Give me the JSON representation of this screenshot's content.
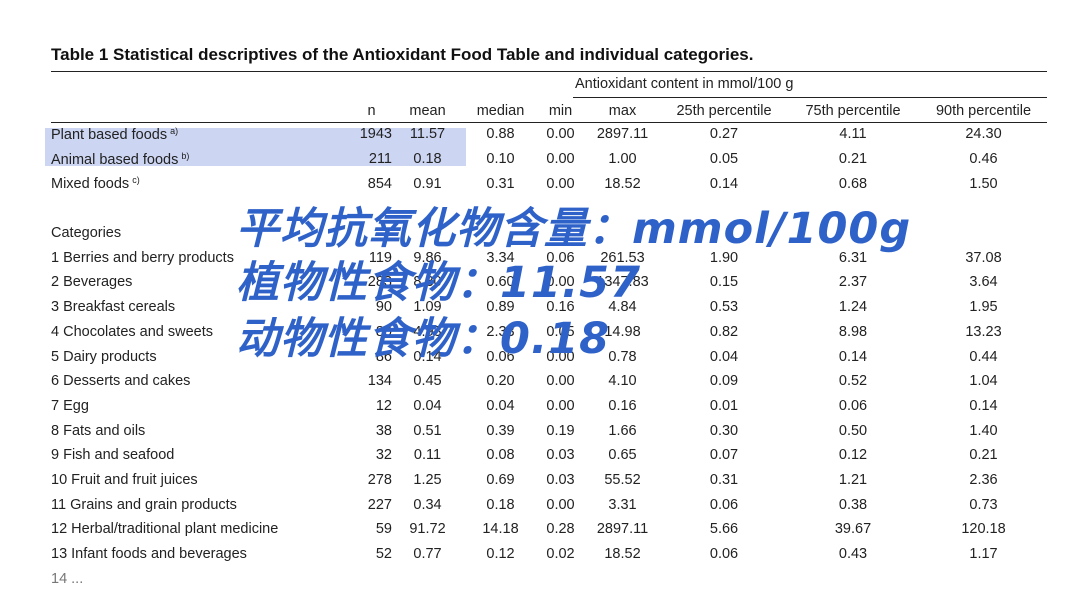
{
  "table": {
    "title": "Table 1 Statistical descriptives of the Antioxidant Food Table and individual categories.",
    "group_header": "Antioxidant content in mmol/100 g",
    "columns": [
      "n",
      "mean",
      "median",
      "min",
      "max",
      "25th percentile",
      "75th percentile",
      "90th percentile"
    ],
    "rows": [
      {
        "label": "Plant based foods",
        "note": "a)",
        "values": [
          "1943",
          "11.57",
          "0.88",
          "0.00",
          "2897.11",
          "0.27",
          "4.11",
          "24.30"
        ]
      },
      {
        "label": "Animal based foods",
        "note": "b)",
        "values": [
          "211",
          "0.18",
          "0.10",
          "0.00",
          "1.00",
          "0.05",
          "0.21",
          "0.46"
        ]
      },
      {
        "label": "Mixed foods",
        "note": "c)",
        "values": [
          "854",
          "0.91",
          "0.31",
          "0.00",
          "18.52",
          "0.14",
          "0.68",
          "1.50"
        ]
      },
      {
        "label": "",
        "note": "",
        "values": [
          "",
          "",
          "",
          "",
          "",
          "",
          "",
          ""
        ]
      },
      {
        "label": "Categories",
        "note": "",
        "values": [
          "",
          "",
          "",
          "",
          "",
          "",
          "",
          ""
        ]
      },
      {
        "label": "1 Berries and berry products",
        "note": "",
        "values": [
          "119",
          "9.86",
          "3.34",
          "0.06",
          "261.53",
          "1.90",
          "6.31",
          "37.08"
        ]
      },
      {
        "label": "2 Beverages",
        "note": "",
        "values": [
          "283",
          "8.30",
          "0.60",
          "0.00",
          "1347.83",
          "0.15",
          "2.37",
          "3.64"
        ]
      },
      {
        "label": "3 Breakfast cereals",
        "note": "",
        "values": [
          "90",
          "1.09",
          "0.89",
          "0.16",
          "4.84",
          "0.53",
          "1.24",
          "1.95"
        ]
      },
      {
        "label": "4 Chocolates and sweets",
        "note": "",
        "values": [
          "80",
          "4.93",
          "2.33",
          "0.05",
          "14.98",
          "0.82",
          "8.98",
          "13.23"
        ]
      },
      {
        "label": "5 Dairy products",
        "note": "",
        "values": [
          "86",
          "0.14",
          "0.06",
          "0.00",
          "0.78",
          "0.04",
          "0.14",
          "0.44"
        ]
      },
      {
        "label": "6 Desserts and cakes",
        "note": "",
        "values": [
          "134",
          "0.45",
          "0.20",
          "0.00",
          "4.10",
          "0.09",
          "0.52",
          "1.04"
        ]
      },
      {
        "label": "7 Egg",
        "note": "",
        "values": [
          "12",
          "0.04",
          "0.04",
          "0.00",
          "0.16",
          "0.01",
          "0.06",
          "0.14"
        ]
      },
      {
        "label": "8 Fats and oils",
        "note": "",
        "values": [
          "38",
          "0.51",
          "0.39",
          "0.19",
          "1.66",
          "0.30",
          "0.50",
          "1.40"
        ]
      },
      {
        "label": "9 Fish and seafood",
        "note": "",
        "values": [
          "32",
          "0.11",
          "0.08",
          "0.03",
          "0.65",
          "0.07",
          "0.12",
          "0.21"
        ]
      },
      {
        "label": "10 Fruit and fruit juices",
        "note": "",
        "values": [
          "278",
          "1.25",
          "0.69",
          "0.03",
          "55.52",
          "0.31",
          "1.21",
          "2.36"
        ]
      },
      {
        "label": "11 Grains and grain products",
        "note": "",
        "values": [
          "227",
          "0.34",
          "0.18",
          "0.00",
          "3.31",
          "0.06",
          "0.38",
          "0.73"
        ]
      },
      {
        "label": "12 Herbal/traditional plant medicine",
        "note": "",
        "values": [
          "59",
          "91.72",
          "14.18",
          "0.28",
          "2897.11",
          "5.66",
          "39.67",
          "120.18"
        ]
      },
      {
        "label": "13 Infant foods and beverages",
        "note": "",
        "values": [
          "52",
          "0.77",
          "0.12",
          "0.02",
          "18.52",
          "0.06",
          "0.43",
          "1.17"
        ]
      },
      {
        "label": "14 ...",
        "note": "",
        "values": [
          "",
          "",
          "",
          "",
          "",
          "",
          "",
          ""
        ]
      }
    ]
  },
  "overlay": {
    "line1": "平均抗氧化物含量：mmol/100g",
    "line2": "植物性食物：11.57",
    "line3": "动物性食物：0.18",
    "color": "#2f62c9"
  },
  "highlight_color": "#ccd5f2"
}
